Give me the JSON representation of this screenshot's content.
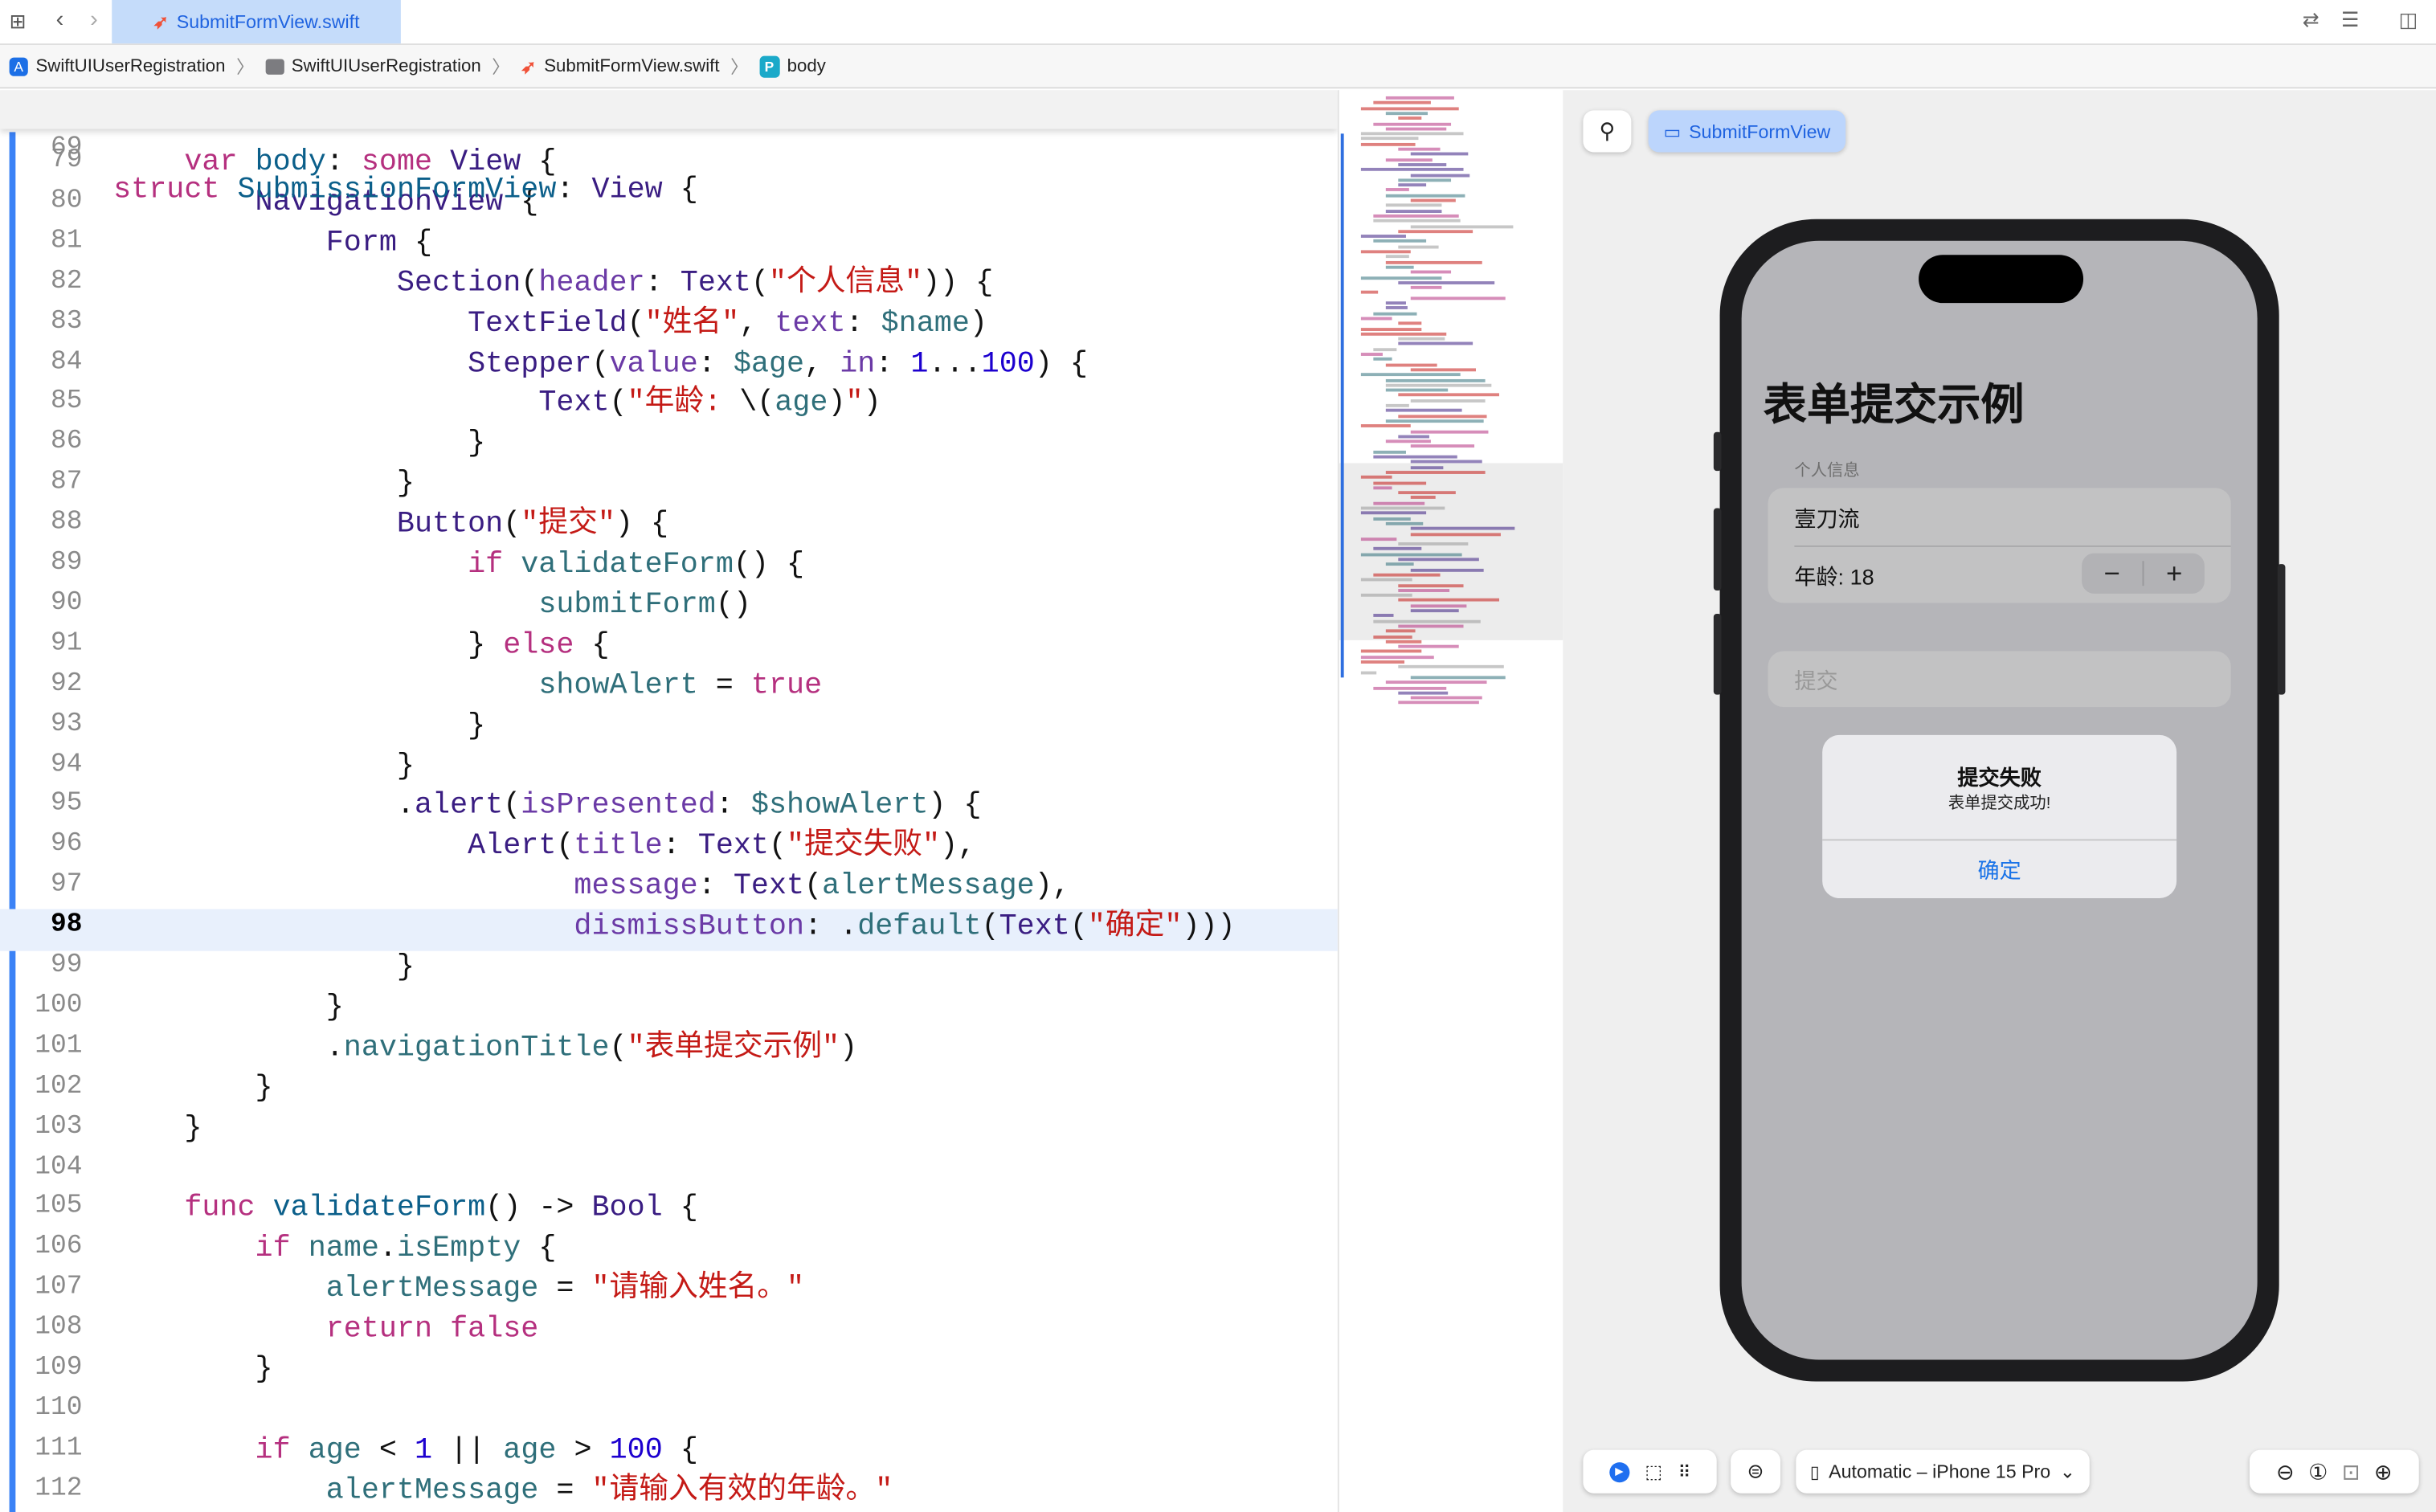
{
  "toolbar": {
    "tab_label": "SubmitFormView.swift",
    "grid_icon": "grid-icon",
    "back_icon": "chevron-left-icon",
    "forward_icon": "chevron-right-icon"
  },
  "breadcrumb": [
    {
      "label": "SwiftUIUserRegistration",
      "icon": "app-icon"
    },
    {
      "label": "SwiftUIUserRegistration",
      "icon": "folder-icon"
    },
    {
      "label": "SubmitFormView.swift",
      "icon": "swift-icon"
    },
    {
      "label": "body",
      "icon": "property-icon"
    }
  ],
  "editor": {
    "sticky": {
      "number": "69",
      "tokens": [
        [
          "k",
          "struct"
        ],
        [
          "p",
          " "
        ],
        [
          "d",
          "SubmissionFormView"
        ],
        [
          "p",
          ": "
        ],
        [
          "t",
          "View"
        ],
        [
          "p",
          " {"
        ]
      ]
    },
    "current_line": "98",
    "lines": [
      {
        "number": "79",
        "tokens": [
          [
            "p",
            "    "
          ],
          [
            "k",
            "var"
          ],
          [
            "p",
            " "
          ],
          [
            "d",
            "body"
          ],
          [
            "p",
            ": "
          ],
          [
            "k",
            "some"
          ],
          [
            "p",
            " "
          ],
          [
            "t",
            "View"
          ],
          [
            "p",
            " {"
          ]
        ]
      },
      {
        "number": "80",
        "tokens": [
          [
            "p",
            "        "
          ],
          [
            "t",
            "NavigationView"
          ],
          [
            "p",
            " {"
          ]
        ]
      },
      {
        "number": "81",
        "tokens": [
          [
            "p",
            "            "
          ],
          [
            "t",
            "Form"
          ],
          [
            "p",
            " {"
          ]
        ]
      },
      {
        "number": "82",
        "tokens": [
          [
            "p",
            "                "
          ],
          [
            "t",
            "Section"
          ],
          [
            "p",
            "("
          ],
          [
            "a",
            "header"
          ],
          [
            "p",
            ": "
          ],
          [
            "t",
            "Text"
          ],
          [
            "p",
            "("
          ],
          [
            "s",
            "\"个人信息\""
          ],
          [
            "p",
            ")) {"
          ]
        ]
      },
      {
        "number": "83",
        "tokens": [
          [
            "p",
            "                    "
          ],
          [
            "t",
            "TextField"
          ],
          [
            "p",
            "("
          ],
          [
            "s",
            "\"姓名\""
          ],
          [
            "p",
            ", "
          ],
          [
            "a",
            "text"
          ],
          [
            "p",
            ": "
          ],
          [
            "f",
            "$name"
          ],
          [
            "p",
            ")"
          ]
        ]
      },
      {
        "number": "84",
        "tokens": [
          [
            "p",
            "                    "
          ],
          [
            "t",
            "Stepper"
          ],
          [
            "p",
            "("
          ],
          [
            "a",
            "value"
          ],
          [
            "p",
            ": "
          ],
          [
            "f",
            "$age"
          ],
          [
            "p",
            ", "
          ],
          [
            "a",
            "in"
          ],
          [
            "p",
            ": "
          ],
          [
            "n",
            "1"
          ],
          [
            "p",
            "..."
          ],
          [
            "n",
            "100"
          ],
          [
            "p",
            ") {"
          ]
        ]
      },
      {
        "number": "85",
        "tokens": [
          [
            "p",
            "                        "
          ],
          [
            "t",
            "Text"
          ],
          [
            "p",
            "("
          ],
          [
            "s",
            "\"年龄: "
          ],
          [
            "p",
            "\\("
          ],
          [
            "f",
            "age"
          ],
          [
            "p",
            ")"
          ],
          [
            "s",
            "\""
          ],
          [
            "p",
            ")"
          ]
        ]
      },
      {
        "number": "86",
        "tokens": [
          [
            "p",
            "                    }"
          ]
        ]
      },
      {
        "number": "87",
        "tokens": [
          [
            "p",
            "                }"
          ]
        ]
      },
      {
        "number": "88",
        "tokens": [
          [
            "p",
            "                "
          ],
          [
            "t",
            "Button"
          ],
          [
            "p",
            "("
          ],
          [
            "s",
            "\"提交\""
          ],
          [
            "p",
            ") {"
          ]
        ]
      },
      {
        "number": "89",
        "tokens": [
          [
            "p",
            "                    "
          ],
          [
            "k",
            "if"
          ],
          [
            "p",
            " "
          ],
          [
            "f",
            "validateForm"
          ],
          [
            "p",
            "() {"
          ]
        ]
      },
      {
        "number": "90",
        "tokens": [
          [
            "p",
            "                        "
          ],
          [
            "f",
            "submitForm"
          ],
          [
            "p",
            "()"
          ]
        ]
      },
      {
        "number": "91",
        "tokens": [
          [
            "p",
            "                    } "
          ],
          [
            "k",
            "else"
          ],
          [
            "p",
            " {"
          ]
        ]
      },
      {
        "number": "92",
        "tokens": [
          [
            "p",
            "                        "
          ],
          [
            "f",
            "showAlert"
          ],
          [
            "p",
            " = "
          ],
          [
            "k",
            "true"
          ]
        ]
      },
      {
        "number": "93",
        "tokens": [
          [
            "p",
            "                    }"
          ]
        ]
      },
      {
        "number": "94",
        "tokens": [
          [
            "p",
            "                }"
          ]
        ]
      },
      {
        "number": "95",
        "tokens": [
          [
            "p",
            "                ."
          ],
          [
            "t",
            "alert"
          ],
          [
            "p",
            "("
          ],
          [
            "a",
            "isPresented"
          ],
          [
            "p",
            ": "
          ],
          [
            "f",
            "$showAlert"
          ],
          [
            "p",
            ") {"
          ]
        ]
      },
      {
        "number": "96",
        "tokens": [
          [
            "p",
            "                    "
          ],
          [
            "t",
            "Alert"
          ],
          [
            "p",
            "("
          ],
          [
            "a",
            "title"
          ],
          [
            "p",
            ": "
          ],
          [
            "t",
            "Text"
          ],
          [
            "p",
            "("
          ],
          [
            "s",
            "\"提交失败\""
          ],
          [
            "p",
            "),"
          ]
        ]
      },
      {
        "number": "97",
        "tokens": [
          [
            "p",
            "                          "
          ],
          [
            "a",
            "message"
          ],
          [
            "p",
            ": "
          ],
          [
            "t",
            "Text"
          ],
          [
            "p",
            "("
          ],
          [
            "f",
            "alertMessage"
          ],
          [
            "p",
            "),"
          ]
        ]
      },
      {
        "number": "98",
        "tokens": [
          [
            "p",
            "                          "
          ],
          [
            "a",
            "dismissButton"
          ],
          [
            "p",
            ": ."
          ],
          [
            "f",
            "default"
          ],
          [
            "p",
            "("
          ],
          [
            "t",
            "Text"
          ],
          [
            "p",
            "("
          ],
          [
            "s",
            "\"确定\""
          ],
          [
            "p",
            ")))"
          ]
        ]
      },
      {
        "number": "99",
        "tokens": [
          [
            "p",
            "                }"
          ]
        ]
      },
      {
        "number": "100",
        "tokens": [
          [
            "p",
            "            }"
          ]
        ]
      },
      {
        "number": "101",
        "tokens": [
          [
            "p",
            "            ."
          ],
          [
            "f",
            "navigationTitle"
          ],
          [
            "p",
            "("
          ],
          [
            "s",
            "\"表单提交示例\""
          ],
          [
            "p",
            ")"
          ]
        ]
      },
      {
        "number": "102",
        "tokens": [
          [
            "p",
            "        }"
          ]
        ]
      },
      {
        "number": "103",
        "tokens": [
          [
            "p",
            "    }"
          ]
        ]
      },
      {
        "number": "104",
        "tokens": []
      },
      {
        "number": "105",
        "tokens": [
          [
            "p",
            "    "
          ],
          [
            "k",
            "func"
          ],
          [
            "p",
            " "
          ],
          [
            "d",
            "validateForm"
          ],
          [
            "p",
            "() -> "
          ],
          [
            "t",
            "Bool"
          ],
          [
            "p",
            " {"
          ]
        ]
      },
      {
        "number": "106",
        "tokens": [
          [
            "p",
            "        "
          ],
          [
            "k",
            "if"
          ],
          [
            "p",
            " "
          ],
          [
            "f",
            "name"
          ],
          [
            "p",
            "."
          ],
          [
            "f",
            "isEmpty"
          ],
          [
            "p",
            " {"
          ]
        ]
      },
      {
        "number": "107",
        "tokens": [
          [
            "p",
            "            "
          ],
          [
            "f",
            "alertMessage"
          ],
          [
            "p",
            " = "
          ],
          [
            "s",
            "\"请输入姓名。\""
          ]
        ]
      },
      {
        "number": "108",
        "tokens": [
          [
            "p",
            "            "
          ],
          [
            "k",
            "return"
          ],
          [
            "p",
            " "
          ],
          [
            "k",
            "false"
          ]
        ]
      },
      {
        "number": "109",
        "tokens": [
          [
            "p",
            "        }"
          ]
        ]
      },
      {
        "number": "110",
        "tokens": []
      },
      {
        "number": "111",
        "tokens": [
          [
            "p",
            "        "
          ],
          [
            "k",
            "if"
          ],
          [
            "p",
            " "
          ],
          [
            "f",
            "age"
          ],
          [
            "p",
            " < "
          ],
          [
            "n",
            "1"
          ],
          [
            "p",
            " || "
          ],
          [
            "f",
            "age"
          ],
          [
            "p",
            " > "
          ],
          [
            "n",
            "100"
          ],
          [
            "p",
            " {"
          ]
        ]
      },
      {
        "number": "112",
        "tokens": [
          [
            "p",
            "            "
          ],
          [
            "f",
            "alertMessage"
          ],
          [
            "p",
            " = "
          ],
          [
            "s",
            "\"请输入有效的年龄。\""
          ]
        ]
      }
    ]
  },
  "preview": {
    "pin_icon": "pin-icon",
    "canvas_tab": "SubmitFormView",
    "app": {
      "nav_title": "表单提交示例",
      "section_header": "个人信息",
      "name_value": "壹刀流",
      "age_label": "年龄: 18",
      "stepper_minus": "−",
      "stepper_plus": "+",
      "submit_label": "提交",
      "alert": {
        "title": "提交失败",
        "message": "表单提交成功!",
        "button": "确定"
      }
    },
    "bottom": {
      "device": "Automatic – iPhone 15 Pro",
      "chevron": "⌄"
    }
  },
  "colors": {
    "accent": "#1f63e0",
    "tab_bg": "#c5dcfa",
    "alert_button": "#1a73e8",
    "keyword": "#b5307f",
    "string": "#c41a16",
    "number": "#1c00cf"
  }
}
